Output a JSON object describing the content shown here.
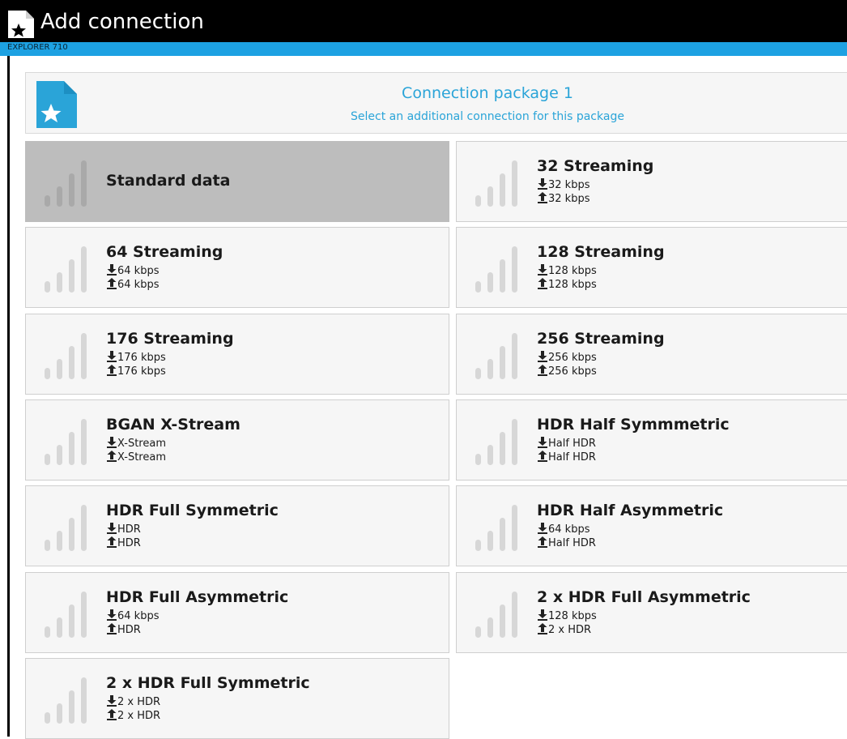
{
  "window": {
    "title": "Add connection",
    "device": "EXPLORER 710"
  },
  "package": {
    "title": "Connection package 1",
    "subtitle": "Select an additional connection for this package"
  },
  "icons": {
    "signal": "signal-bars-icon",
    "download": "download-arrow-icon",
    "upload": "upload-arrow-icon",
    "package": "star-document-icon"
  },
  "colors": {
    "accent": "#1da1e2",
    "titlebar": "#000000",
    "selected_tile": "#bdbdbd",
    "tile": "#f6f6f6",
    "link_text": "#2aa4d8"
  },
  "connections": [
    {
      "name": "Standard data",
      "selected": true
    },
    {
      "name": "32 Streaming",
      "down": "32 kbps",
      "up": "32 kbps"
    },
    {
      "name": "64 Streaming",
      "down": "64 kbps",
      "up": "64 kbps"
    },
    {
      "name": "128 Streaming",
      "down": "128 kbps",
      "up": "128 kbps"
    },
    {
      "name": "176 Streaming",
      "down": "176 kbps",
      "up": "176 kbps"
    },
    {
      "name": "256 Streaming",
      "down": "256 kbps",
      "up": "256 kbps"
    },
    {
      "name": "BGAN X-Stream",
      "down": "X-Stream",
      "up": "X-Stream"
    },
    {
      "name": "HDR Half Symmmetric",
      "down": "Half HDR",
      "up": "Half HDR"
    },
    {
      "name": "HDR Full Symmetric",
      "down": "HDR",
      "up": "HDR"
    },
    {
      "name": "HDR Half Asymmetric",
      "down": "64 kbps",
      "up": "Half HDR"
    },
    {
      "name": "HDR Full Asymmetric",
      "down": "64 kbps",
      "up": "HDR"
    },
    {
      "name": "2 x HDR Full Asymmetric",
      "down": "128 kbps",
      "up": "2 x HDR"
    },
    {
      "name": "2 x HDR Full Symmetric",
      "down": "2 x HDR",
      "up": "2 x HDR"
    }
  ]
}
